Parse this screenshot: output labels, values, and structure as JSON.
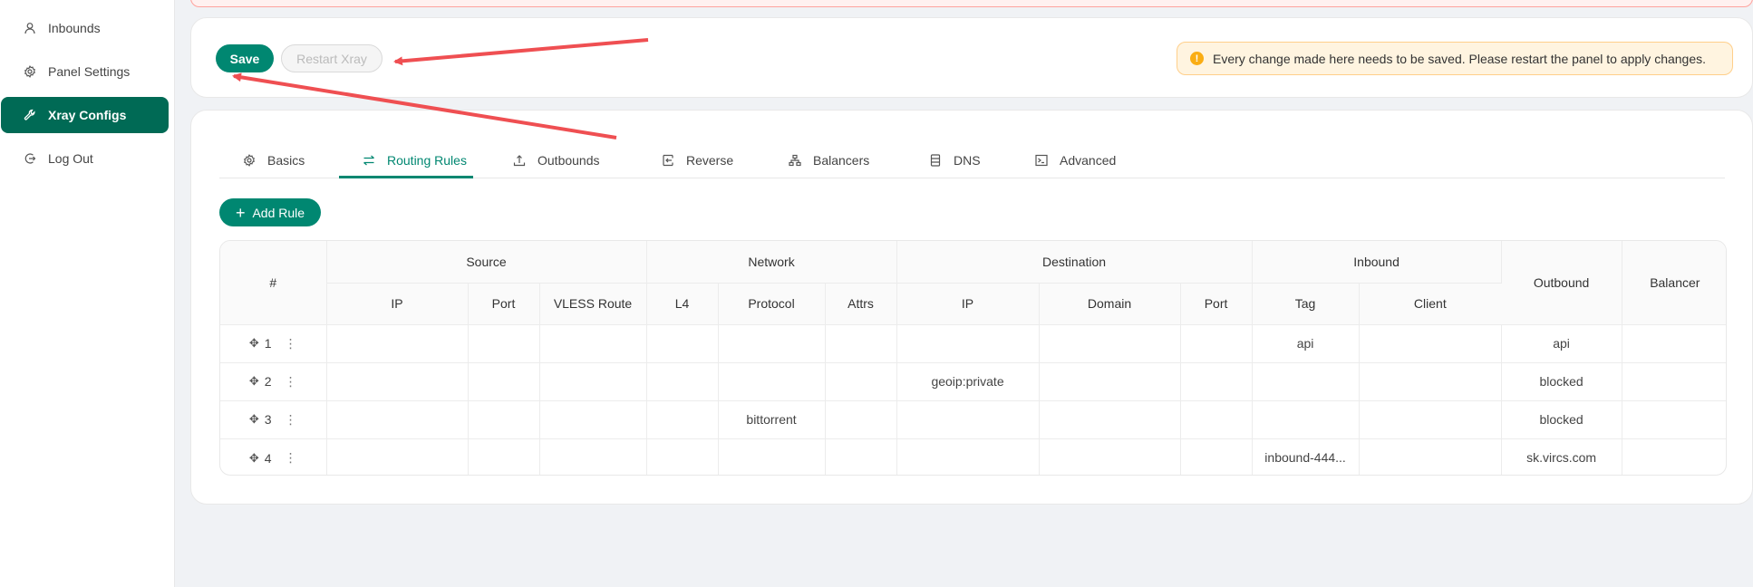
{
  "sidebar": {
    "items": [
      {
        "label": "Inbounds",
        "icon": "user-icon"
      },
      {
        "label": "Panel Settings",
        "icon": "gear-icon"
      },
      {
        "label": "Xray Configs",
        "icon": "tool-icon",
        "active": true
      },
      {
        "label": "Log Out",
        "icon": "logout-icon"
      }
    ]
  },
  "toolbar": {
    "save_label": "Save",
    "restart_label": "Restart Xray",
    "notice": "Every change made here needs to be saved. Please restart the panel to apply changes."
  },
  "tabs": [
    {
      "label": "Basics",
      "icon": "gear-icon"
    },
    {
      "label": "Routing Rules",
      "icon": "swap-icon",
      "active": true
    },
    {
      "label": "Outbounds",
      "icon": "upload-icon"
    },
    {
      "label": "Reverse",
      "icon": "import-icon"
    },
    {
      "label": "Balancers",
      "icon": "cluster-icon"
    },
    {
      "label": "DNS",
      "icon": "database-icon"
    },
    {
      "label": "Advanced",
      "icon": "code-icon"
    }
  ],
  "add_rule_label": "Add Rule",
  "table": {
    "group_headers": {
      "index": "#",
      "source": "Source",
      "network": "Network",
      "destination": "Destination",
      "inbound": "Inbound",
      "outbound": "Outbound",
      "balancer": "Balancer"
    },
    "sub_headers": [
      "IP",
      "Port",
      "VLESS Route",
      "L4",
      "Protocol",
      "Attrs",
      "IP",
      "Domain",
      "Port",
      "Tag",
      "Client"
    ],
    "rows": [
      {
        "index": "1",
        "cells": [
          "",
          "",
          "",
          "",
          "",
          "",
          "",
          "",
          "",
          "api",
          "",
          "api",
          ""
        ]
      },
      {
        "index": "2",
        "cells": [
          "",
          "",
          "",
          "",
          "",
          "",
          "geoip:private",
          "",
          "",
          "",
          "",
          "blocked",
          ""
        ]
      },
      {
        "index": "3",
        "cells": [
          "",
          "",
          "",
          "",
          "bittorrent",
          "",
          "",
          "",
          "",
          "",
          "",
          "blocked",
          ""
        ]
      },
      {
        "index": "4",
        "cells": [
          "",
          "",
          "",
          "",
          "",
          "",
          "",
          "",
          "",
          "inbound-444...",
          "",
          "sk.vircs.com",
          ""
        ]
      }
    ]
  },
  "colors": {
    "accent": "#008771",
    "sidebar_active": "#006a55",
    "annotation_arrow": "#ef4f52",
    "notice_bg": "#fff4e0"
  }
}
